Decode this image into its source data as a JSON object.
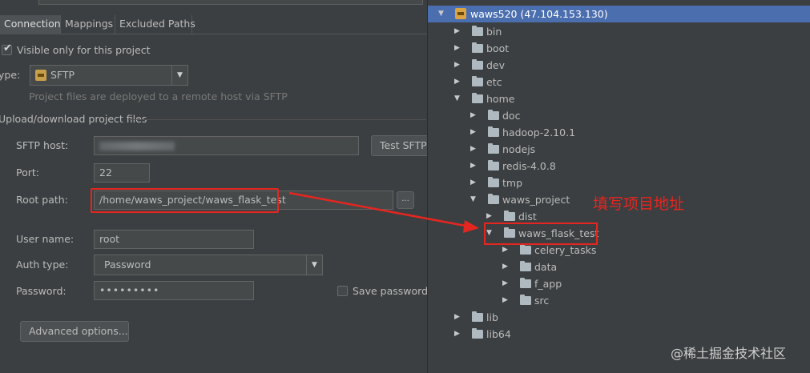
{
  "tabs": [
    "Connection",
    "Mappings",
    "Excluded Paths"
  ],
  "visible_only": {
    "label": "Visible only for this project",
    "checked": true
  },
  "type": {
    "label": "ype:",
    "value": "SFTP",
    "hint": "Project files are deployed to a remote host via SFTP"
  },
  "section_title": "Upload/download project files",
  "sftp_host": {
    "label": "SFTP host:",
    "button": "Test SFTP"
  },
  "port": {
    "label": "Port:",
    "value": "22"
  },
  "root_path": {
    "label": "Root path:",
    "value": "/home/waws_project/waws_flask_test",
    "browse": "..."
  },
  "user_name": {
    "label": "User name:",
    "value": "root"
  },
  "auth_type": {
    "label": "Auth type:",
    "value": "Password"
  },
  "password": {
    "label": "Password:",
    "value": "•••••••••"
  },
  "save_password": {
    "label": "Save password",
    "checked": false
  },
  "advanced": "Advanced options...",
  "tree": {
    "root": "waws520 (47.104.153.130)",
    "items": [
      {
        "label": "bin",
        "level": 1,
        "expanded": false
      },
      {
        "label": "boot",
        "level": 1,
        "expanded": false
      },
      {
        "label": "dev",
        "level": 1,
        "expanded": false
      },
      {
        "label": "etc",
        "level": 1,
        "expanded": false
      },
      {
        "label": "home",
        "level": 1,
        "expanded": true
      },
      {
        "label": "doc",
        "level": 2,
        "expanded": false
      },
      {
        "label": "hadoop-2.10.1",
        "level": 2,
        "expanded": false
      },
      {
        "label": "nodejs",
        "level": 2,
        "expanded": false
      },
      {
        "label": "redis-4.0.8",
        "level": 2,
        "expanded": false
      },
      {
        "label": "tmp",
        "level": 2,
        "expanded": false
      },
      {
        "label": "waws_project",
        "level": 2,
        "expanded": true
      },
      {
        "label": "dist",
        "level": 3,
        "expanded": false
      },
      {
        "label": "waws_flask_test",
        "level": 3,
        "expanded": true
      },
      {
        "label": "celery_tasks",
        "level": 4,
        "expanded": false
      },
      {
        "label": "data",
        "level": 4,
        "expanded": false
      },
      {
        "label": "f_app",
        "level": 4,
        "expanded": false
      },
      {
        "label": "src",
        "level": 4,
        "expanded": false
      },
      {
        "label": "lib",
        "level": 1,
        "expanded": false
      },
      {
        "label": "lib64",
        "level": 1,
        "expanded": false
      }
    ]
  },
  "annotation": "填写项目地址",
  "watermark": "@稀土掘金技术社区",
  "colors": {
    "highlight": "#e52620",
    "selection": "#4b6eaf",
    "background": "#3c3f41"
  }
}
